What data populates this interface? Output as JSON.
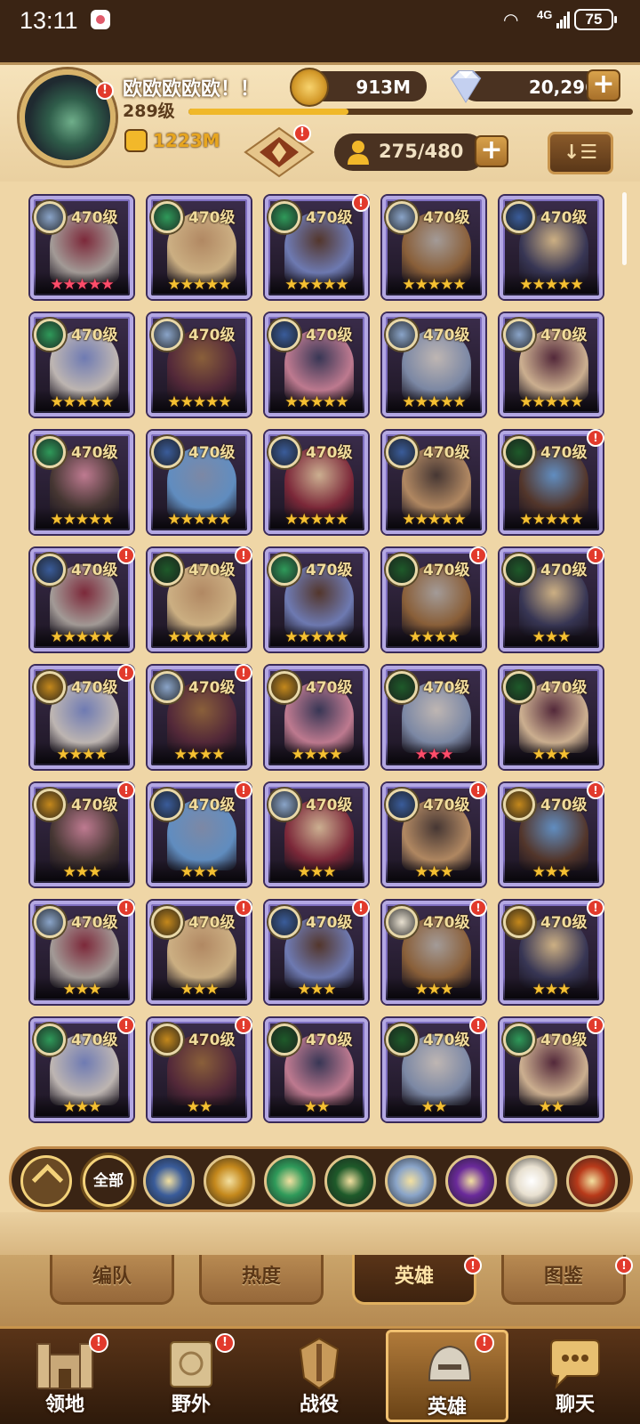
{
  "status_bar": {
    "time": "13:11",
    "network": "4G",
    "battery": "75"
  },
  "player": {
    "name": "欧欧欧欧欧！！",
    "level": "289级",
    "power": "1223M",
    "xp_fraction": 0.36,
    "notif": "!"
  },
  "resources": {
    "gold": "913M",
    "gems": "20,296"
  },
  "heroes_count": "275/480",
  "hero_level_label": "470级",
  "heroes": [
    {
      "faction": "celestial",
      "stars": 5,
      "red": true,
      "notif": false
    },
    {
      "faction": "wilder",
      "stars": 5,
      "red": false,
      "notif": false
    },
    {
      "faction": "wilder",
      "stars": 5,
      "red": false,
      "notif": true
    },
    {
      "faction": "celestial",
      "stars": 5,
      "red": false,
      "notif": false
    },
    {
      "faction": "lightbearer",
      "stars": 5,
      "red": false,
      "notif": false
    },
    {
      "faction": "wilder",
      "stars": 5,
      "red": false,
      "notif": false
    },
    {
      "faction": "celestial",
      "stars": 5,
      "red": false,
      "notif": false
    },
    {
      "faction": "lightbearer",
      "stars": 5,
      "red": false,
      "notif": false
    },
    {
      "faction": "celestial",
      "stars": 5,
      "red": false,
      "notif": false
    },
    {
      "faction": "celestial",
      "stars": 5,
      "red": false,
      "notif": false
    },
    {
      "faction": "wilder",
      "stars": 5,
      "red": false,
      "notif": false
    },
    {
      "faction": "lightbearer",
      "stars": 5,
      "red": false,
      "notif": false
    },
    {
      "faction": "lightbearer",
      "stars": 5,
      "red": false,
      "notif": false
    },
    {
      "faction": "lightbearer",
      "stars": 5,
      "red": false,
      "notif": false
    },
    {
      "faction": "graveborn",
      "stars": 5,
      "red": false,
      "notif": true
    },
    {
      "faction": "lightbearer",
      "stars": 5,
      "red": false,
      "notif": true
    },
    {
      "faction": "graveborn",
      "stars": 5,
      "red": false,
      "notif": true
    },
    {
      "faction": "wilder",
      "stars": 5,
      "red": false,
      "notif": false
    },
    {
      "faction": "graveborn",
      "stars": 4,
      "red": false,
      "notif": true
    },
    {
      "faction": "graveborn",
      "stars": 3,
      "red": false,
      "notif": true
    },
    {
      "faction": "maulers",
      "stars": 4,
      "red": false,
      "notif": true
    },
    {
      "faction": "celestial",
      "stars": 4,
      "red": false,
      "notif": true
    },
    {
      "faction": "maulers",
      "stars": 4,
      "red": false,
      "notif": false
    },
    {
      "faction": "graveborn",
      "stars": 3,
      "red": true,
      "notif": false
    },
    {
      "faction": "graveborn",
      "stars": 3,
      "red": false,
      "notif": false
    },
    {
      "faction": "maulers",
      "stars": 3,
      "red": false,
      "notif": true
    },
    {
      "faction": "lightbearer",
      "stars": 3,
      "red": false,
      "notif": true
    },
    {
      "faction": "celestial",
      "stars": 3,
      "red": false,
      "notif": false
    },
    {
      "faction": "lightbearer",
      "stars": 3,
      "red": false,
      "notif": true
    },
    {
      "faction": "maulers",
      "stars": 3,
      "red": false,
      "notif": true
    },
    {
      "faction": "celestial",
      "stars": 3,
      "red": false,
      "notif": true
    },
    {
      "faction": "maulers",
      "stars": 3,
      "red": false,
      "notif": true
    },
    {
      "faction": "lightbearer",
      "stars": 3,
      "red": false,
      "notif": true
    },
    {
      "faction": "dimensional",
      "stars": 3,
      "red": false,
      "notif": true
    },
    {
      "faction": "maulers",
      "stars": 3,
      "red": false,
      "notif": true
    },
    {
      "faction": "wilder",
      "stars": 3,
      "red": false,
      "notif": true
    },
    {
      "faction": "maulers",
      "stars": 2,
      "red": false,
      "notif": true
    },
    {
      "faction": "graveborn",
      "stars": 2,
      "red": false,
      "notif": false
    },
    {
      "faction": "graveborn",
      "stars": 2,
      "red": false,
      "notif": true
    },
    {
      "faction": "wilder",
      "stars": 2,
      "red": false,
      "notif": true
    }
  ],
  "faction_filter": {
    "all_label": "全部",
    "factions": [
      "lightbearer",
      "maulers",
      "wilder",
      "graveborn",
      "celestial",
      "hypogean",
      "dimensional",
      "draconis"
    ]
  },
  "tabs": {
    "formation": "编队",
    "popularity": "热度",
    "heroes": "英雄",
    "codex": "图鉴"
  },
  "nav": {
    "territory": "领地",
    "wild": "野外",
    "campaign": "战役",
    "heroes": "英雄",
    "chat": "聊天"
  },
  "faction_colors": {
    "lightbearer": "#3a5c9a",
    "maulers": "#c4881c",
    "wilder": "#2f9a5a",
    "graveborn": "#1e5a2a",
    "celestial": "#8aa4c8",
    "hypogean": "#6a2a9a",
    "dimensional": "#e8e0d0",
    "draconis": "#b83a1a"
  }
}
